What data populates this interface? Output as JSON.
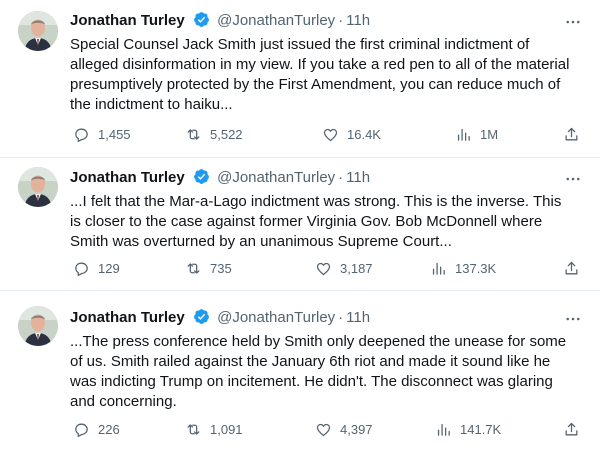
{
  "accent_color": "#1d9bf0",
  "tweets": [
    {
      "author": {
        "name": "Jonathan Turley",
        "handle": "@JonathanTurley",
        "verified_icon": "verified-badge-icon"
      },
      "separator": "·",
      "time": "11h",
      "text": "Special Counsel Jack Smith just issued the first criminal indictment of alleged disinformation in my view. If you take a red pen to all of the material presumptively protected by the First Amendment, you can reduce much of the indictment to haiku...",
      "stats": {
        "replies": "1,455",
        "retweets": "5,522",
        "likes": "16.4K",
        "views": "1M"
      }
    },
    {
      "author": {
        "name": "Jonathan Turley",
        "handle": "@JonathanTurley",
        "verified_icon": "verified-badge-icon"
      },
      "separator": "·",
      "time": "11h",
      "text": "...I felt that the Mar-a-Lago indictment was strong. This is the inverse.  This is closer to the case against former Virginia Gov. Bob McDonnell where Smith was overturned by an unanimous Supreme Court...",
      "stats": {
        "replies": "129",
        "retweets": "735",
        "likes": "3,187",
        "views": "137.3K"
      }
    },
    {
      "author": {
        "name": "Jonathan Turley",
        "handle": "@JonathanTurley",
        "verified_icon": "verified-badge-icon"
      },
      "separator": "·",
      "time": "11h",
      "text": "...The press conference held by Smith only deepened the unease for some of us. Smith railed against the January 6th riot and made it sound like he was indicting Trump on incitement. He didn't. The disconnect was glaring and concerning.",
      "stats": {
        "replies": "226",
        "retweets": "1,091",
        "likes": "4,397",
        "views": "141.7K"
      }
    }
  ]
}
